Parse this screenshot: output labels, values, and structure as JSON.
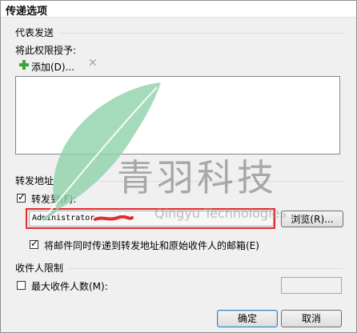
{
  "window": {
    "title": "传递选项"
  },
  "representation": {
    "section_title": "代表发送",
    "grant_label": "将此权限授予:",
    "add_label": "添加(D)...",
    "recipients": []
  },
  "forwarding": {
    "section_title": "转发地址",
    "forward_to_label": "转发到(F):",
    "forward_to_checked": true,
    "forward_value": "Administrator",
    "browse_label": "浏览(R)...",
    "deliver_both_label": "将邮件同时传递到转发地址和原始收件人的邮箱(E)",
    "deliver_both_checked": true
  },
  "limits": {
    "section_title": "收件人限制",
    "max_recipients_label": "最大收件人数(M):",
    "max_recipients_checked": false,
    "max_recipients_value": ""
  },
  "buttons": {
    "ok_label": "确定",
    "cancel_label": "取消"
  },
  "watermark": {
    "main": "青羽科技",
    "sub": "Qingyu Technologies"
  },
  "colors": {
    "annotation_red": "#e52b2b",
    "feather_green": "#8fd2aa",
    "add_icon_green": "#3aa53a"
  }
}
